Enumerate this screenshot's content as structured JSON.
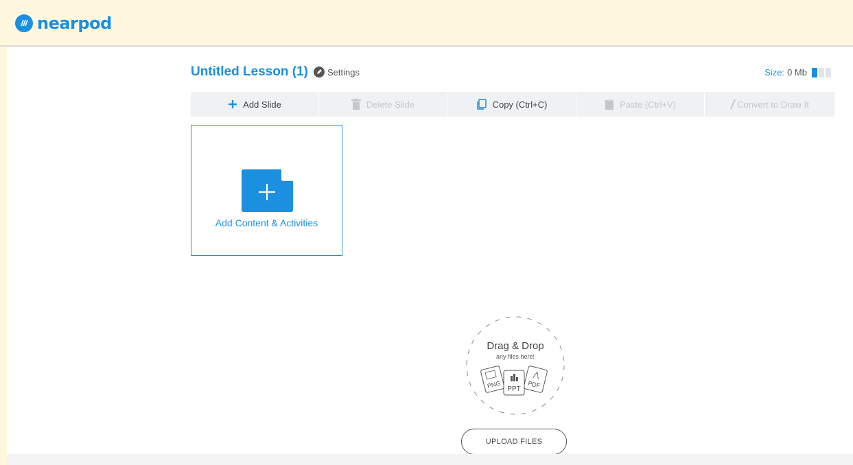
{
  "app": {
    "brand": "nearpod",
    "accent_color": "#1b8fe0"
  },
  "lesson": {
    "title": "Untitled Lesson (1)",
    "settings_label": "Settings",
    "size_label": "Size:",
    "size_value": "0 Mb"
  },
  "toolbar": {
    "add_slide": "Add Slide",
    "delete_slide": "Delete Slide",
    "copy": "Copy (Ctrl+C)",
    "paste": "Paste (Ctrl+V)",
    "convert": "Convert to Draw It"
  },
  "add_card": {
    "label": "Add Content & Activities"
  },
  "dropzone": {
    "title": "Drag & Drop",
    "subtitle": "any files here!",
    "file_types": [
      "PNG",
      "PPT",
      "PDF"
    ],
    "upload_button": "UPLOAD FILES"
  }
}
